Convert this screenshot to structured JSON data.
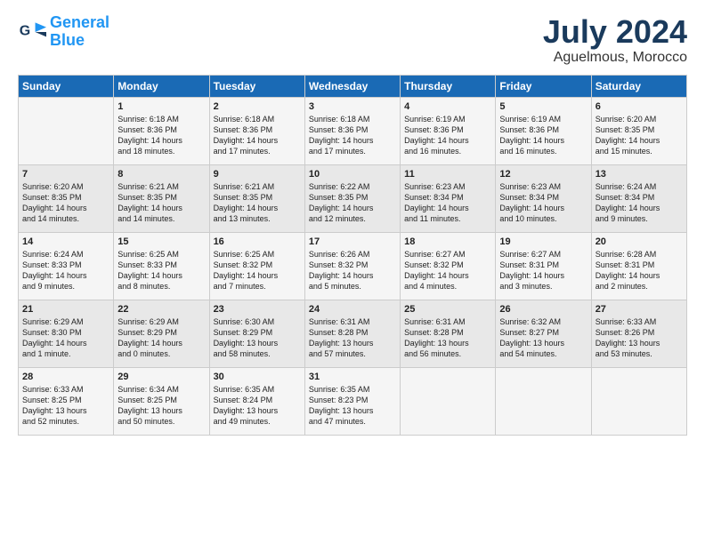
{
  "header": {
    "logo_line1": "General",
    "logo_line2": "Blue",
    "month": "July 2024",
    "location": "Aguelmous, Morocco"
  },
  "weekdays": [
    "Sunday",
    "Monday",
    "Tuesday",
    "Wednesday",
    "Thursday",
    "Friday",
    "Saturday"
  ],
  "weeks": [
    [
      {
        "day": "",
        "info": ""
      },
      {
        "day": "1",
        "info": "Sunrise: 6:18 AM\nSunset: 8:36 PM\nDaylight: 14 hours\nand 18 minutes."
      },
      {
        "day": "2",
        "info": "Sunrise: 6:18 AM\nSunset: 8:36 PM\nDaylight: 14 hours\nand 17 minutes."
      },
      {
        "day": "3",
        "info": "Sunrise: 6:18 AM\nSunset: 8:36 PM\nDaylight: 14 hours\nand 17 minutes."
      },
      {
        "day": "4",
        "info": "Sunrise: 6:19 AM\nSunset: 8:36 PM\nDaylight: 14 hours\nand 16 minutes."
      },
      {
        "day": "5",
        "info": "Sunrise: 6:19 AM\nSunset: 8:36 PM\nDaylight: 14 hours\nand 16 minutes."
      },
      {
        "day": "6",
        "info": "Sunrise: 6:20 AM\nSunset: 8:35 PM\nDaylight: 14 hours\nand 15 minutes."
      }
    ],
    [
      {
        "day": "7",
        "info": "Sunrise: 6:20 AM\nSunset: 8:35 PM\nDaylight: 14 hours\nand 14 minutes."
      },
      {
        "day": "8",
        "info": "Sunrise: 6:21 AM\nSunset: 8:35 PM\nDaylight: 14 hours\nand 14 minutes."
      },
      {
        "day": "9",
        "info": "Sunrise: 6:21 AM\nSunset: 8:35 PM\nDaylight: 14 hours\nand 13 minutes."
      },
      {
        "day": "10",
        "info": "Sunrise: 6:22 AM\nSunset: 8:35 PM\nDaylight: 14 hours\nand 12 minutes."
      },
      {
        "day": "11",
        "info": "Sunrise: 6:23 AM\nSunset: 8:34 PM\nDaylight: 14 hours\nand 11 minutes."
      },
      {
        "day": "12",
        "info": "Sunrise: 6:23 AM\nSunset: 8:34 PM\nDaylight: 14 hours\nand 10 minutes."
      },
      {
        "day": "13",
        "info": "Sunrise: 6:24 AM\nSunset: 8:34 PM\nDaylight: 14 hours\nand 9 minutes."
      }
    ],
    [
      {
        "day": "14",
        "info": "Sunrise: 6:24 AM\nSunset: 8:33 PM\nDaylight: 14 hours\nand 9 minutes."
      },
      {
        "day": "15",
        "info": "Sunrise: 6:25 AM\nSunset: 8:33 PM\nDaylight: 14 hours\nand 8 minutes."
      },
      {
        "day": "16",
        "info": "Sunrise: 6:25 AM\nSunset: 8:32 PM\nDaylight: 14 hours\nand 7 minutes."
      },
      {
        "day": "17",
        "info": "Sunrise: 6:26 AM\nSunset: 8:32 PM\nDaylight: 14 hours\nand 5 minutes."
      },
      {
        "day": "18",
        "info": "Sunrise: 6:27 AM\nSunset: 8:32 PM\nDaylight: 14 hours\nand 4 minutes."
      },
      {
        "day": "19",
        "info": "Sunrise: 6:27 AM\nSunset: 8:31 PM\nDaylight: 14 hours\nand 3 minutes."
      },
      {
        "day": "20",
        "info": "Sunrise: 6:28 AM\nSunset: 8:31 PM\nDaylight: 14 hours\nand 2 minutes."
      }
    ],
    [
      {
        "day": "21",
        "info": "Sunrise: 6:29 AM\nSunset: 8:30 PM\nDaylight: 14 hours\nand 1 minute."
      },
      {
        "day": "22",
        "info": "Sunrise: 6:29 AM\nSunset: 8:29 PM\nDaylight: 14 hours\nand 0 minutes."
      },
      {
        "day": "23",
        "info": "Sunrise: 6:30 AM\nSunset: 8:29 PM\nDaylight: 13 hours\nand 58 minutes."
      },
      {
        "day": "24",
        "info": "Sunrise: 6:31 AM\nSunset: 8:28 PM\nDaylight: 13 hours\nand 57 minutes."
      },
      {
        "day": "25",
        "info": "Sunrise: 6:31 AM\nSunset: 8:28 PM\nDaylight: 13 hours\nand 56 minutes."
      },
      {
        "day": "26",
        "info": "Sunrise: 6:32 AM\nSunset: 8:27 PM\nDaylight: 13 hours\nand 54 minutes."
      },
      {
        "day": "27",
        "info": "Sunrise: 6:33 AM\nSunset: 8:26 PM\nDaylight: 13 hours\nand 53 minutes."
      }
    ],
    [
      {
        "day": "28",
        "info": "Sunrise: 6:33 AM\nSunset: 8:25 PM\nDaylight: 13 hours\nand 52 minutes."
      },
      {
        "day": "29",
        "info": "Sunrise: 6:34 AM\nSunset: 8:25 PM\nDaylight: 13 hours\nand 50 minutes."
      },
      {
        "day": "30",
        "info": "Sunrise: 6:35 AM\nSunset: 8:24 PM\nDaylight: 13 hours\nand 49 minutes."
      },
      {
        "day": "31",
        "info": "Sunrise: 6:35 AM\nSunset: 8:23 PM\nDaylight: 13 hours\nand 47 minutes."
      },
      {
        "day": "",
        "info": ""
      },
      {
        "day": "",
        "info": ""
      },
      {
        "day": "",
        "info": ""
      }
    ]
  ]
}
